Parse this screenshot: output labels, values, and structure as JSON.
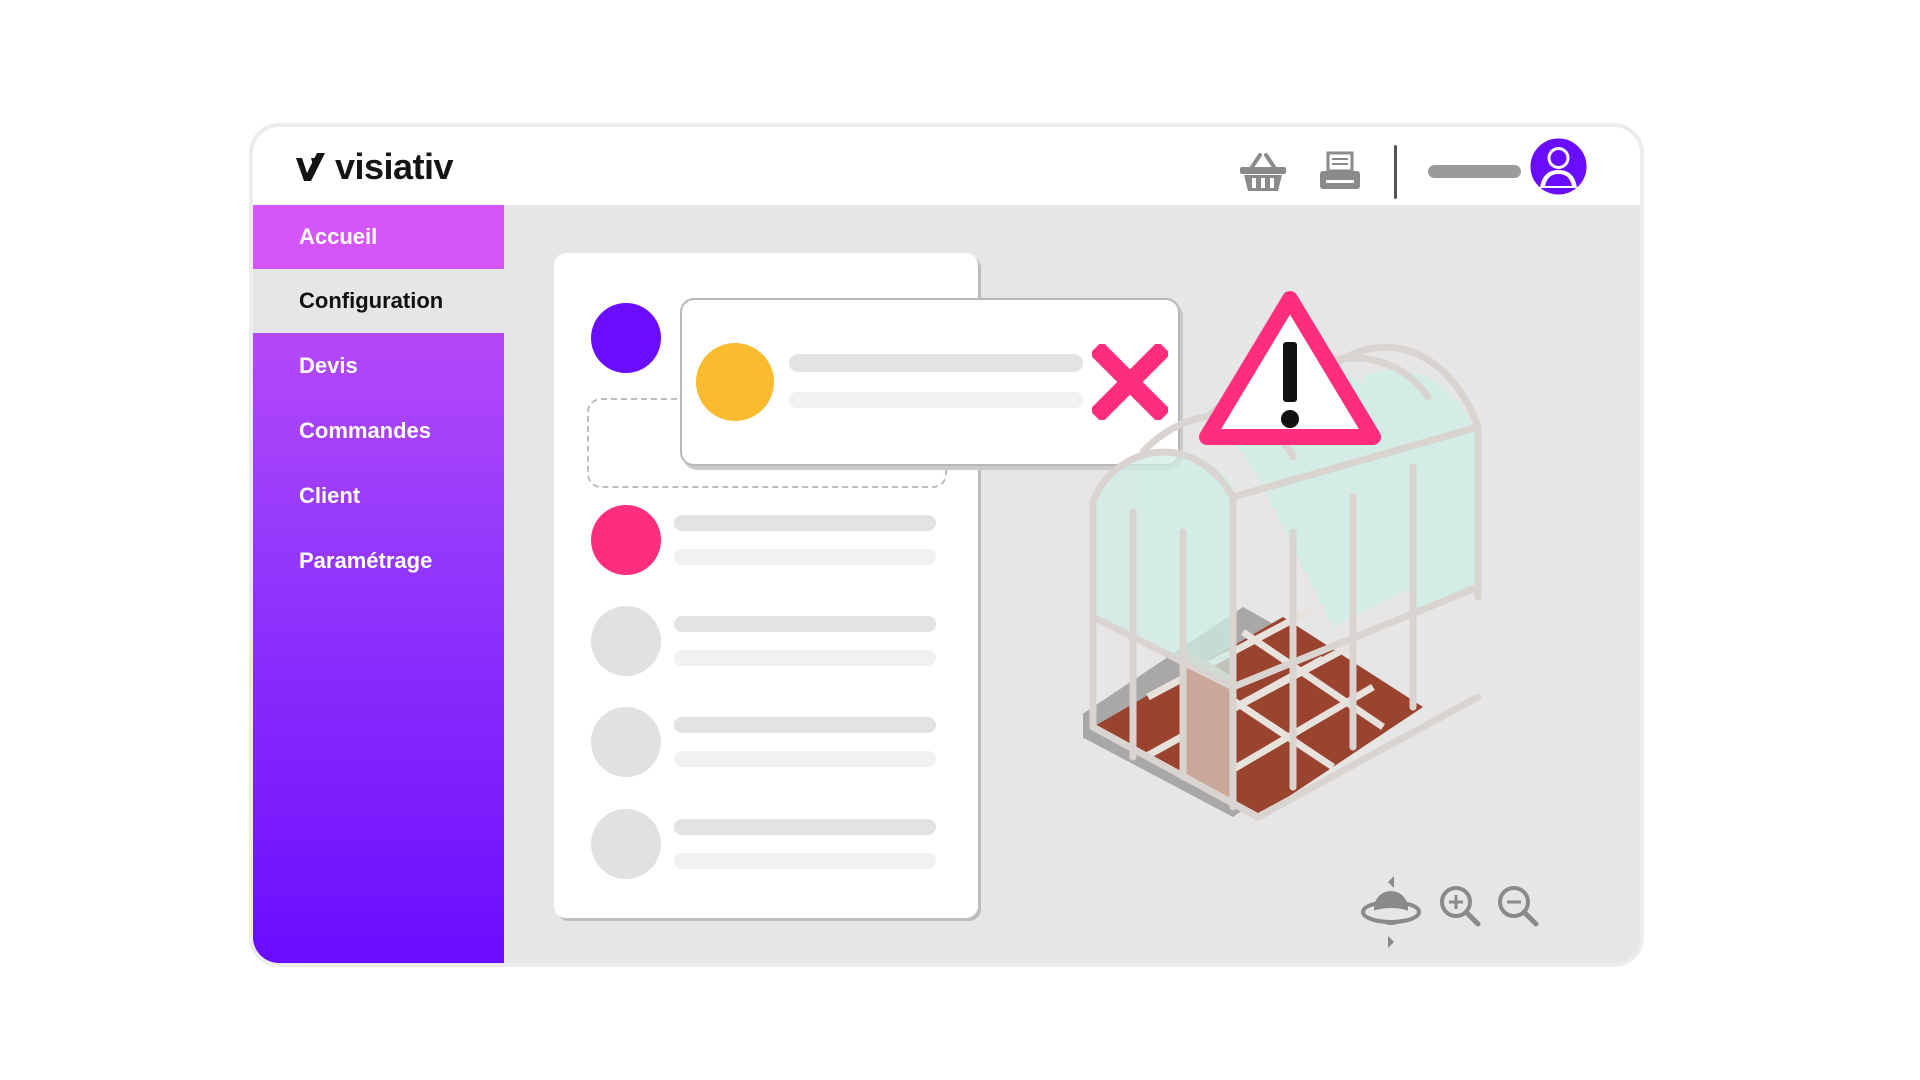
{
  "brand": {
    "name": "visiativ"
  },
  "nav": {
    "items": [
      {
        "label": "Accueil"
      },
      {
        "label": "Configuration"
      },
      {
        "label": "Devis"
      },
      {
        "label": "Commandes"
      },
      {
        "label": "Client"
      },
      {
        "label": "Paramétrage"
      }
    ],
    "active_index": 1
  },
  "toolbar": {
    "icons": [
      "basket-icon",
      "printer-icon",
      "user-avatar-icon"
    ]
  },
  "viewer": {
    "icons": [
      "rotate-3d-icon",
      "zoom-in-icon",
      "zoom-out-icon",
      "warning-icon",
      "close-icon"
    ]
  },
  "colors": {
    "accent_purple": "#6a0cfd",
    "accent_pink": "#ff2d7e",
    "accent_yellow": "#fbbb2f",
    "nav_top": "#c951f7",
    "greenhouse_floor": "#9a4430"
  }
}
